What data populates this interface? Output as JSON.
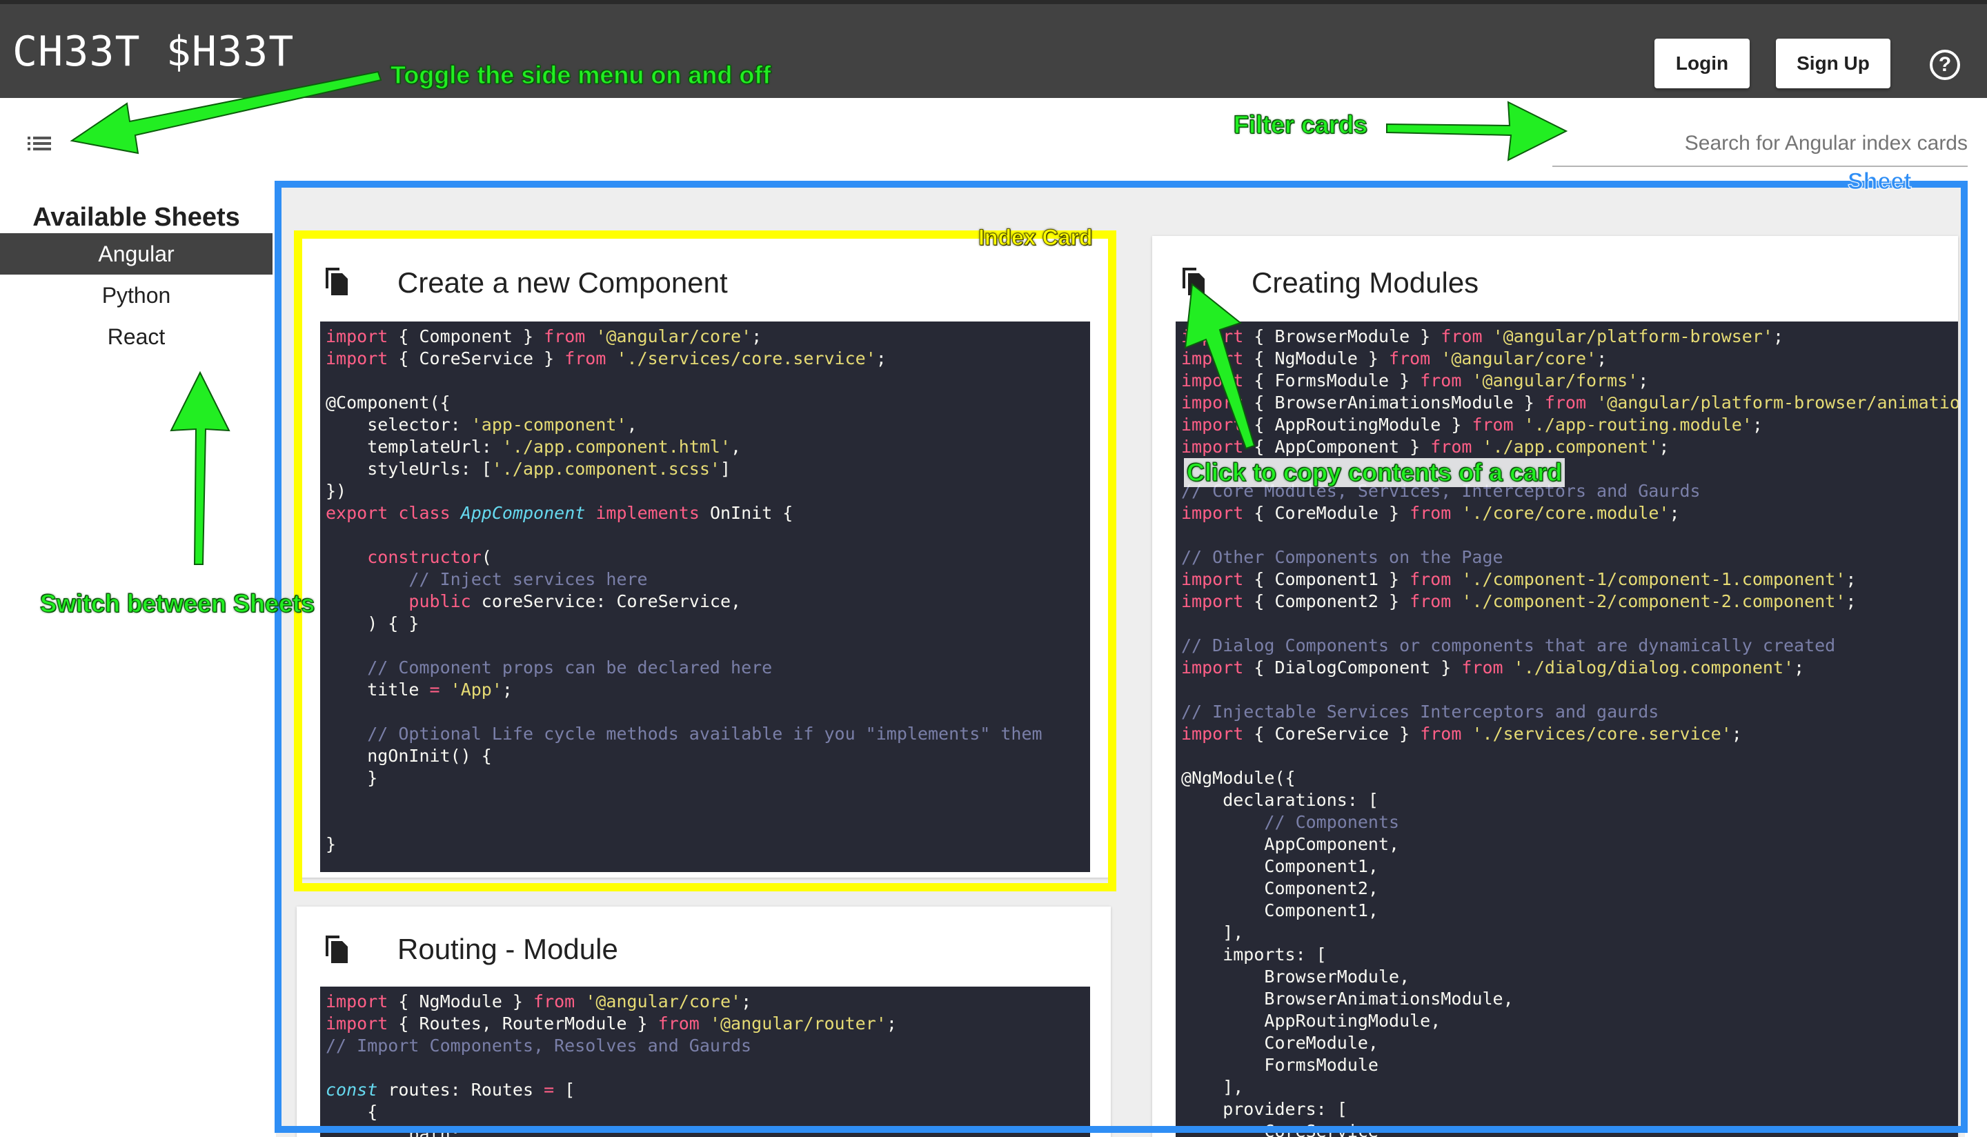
{
  "header": {
    "logo": "CH33T $H33T",
    "login_label": "Login",
    "signup_label": "Sign Up",
    "help_glyph": "?"
  },
  "toolbar": {
    "menu_icon": "list-icon",
    "search_placeholder": "Search for Angular index cards"
  },
  "sidebar": {
    "title": "Available Sheets",
    "items": [
      {
        "label": "Angular",
        "active": true
      },
      {
        "label": "Python",
        "active": false
      },
      {
        "label": "React",
        "active": false
      }
    ]
  },
  "cards": [
    {
      "title": "Create a new Component",
      "code_lines": [
        "import { Component } from '@angular/core';",
        "import { CoreService } from './services/core.service';",
        "",
        "@Component({",
        "    selector: 'app-component',",
        "    templateUrl: './app.component.html',",
        "    styleUrls: ['./app.component.scss']",
        "})",
        "export class AppComponent implements OnInit {",
        "",
        "    constructor(",
        "        // Inject services here",
        "        public coreService: CoreService,",
        "    ) { }",
        "",
        "    // Component props can be declared here",
        "    title = 'App';",
        "",
        "    // Optional Life cycle methods available if you \"implements\" them",
        "    ngOnInit() {",
        "    }",
        "",
        "",
        "}"
      ]
    },
    {
      "title": "Routing - Module",
      "code_lines": [
        "import { NgModule } from '@angular/core';",
        "import { Routes, RouterModule } from '@angular/router';",
        "// Import Components, Resolves and Gaurds",
        "",
        "const routes: Routes = [",
        "    {",
        "        path: ''"
      ]
    },
    {
      "title": "Creating Modules",
      "code_lines": [
        "import { BrowserModule } from '@angular/platform-browser';",
        "import { NgModule } from '@angular/core';",
        "import { FormsModule } from '@angular/forms';",
        "import { BrowserAnimationsModule } from '@angular/platform-browser/animations';",
        "import { AppRoutingModule } from './app-routing.module';",
        "import { AppComponent } from './app.component';",
        "",
        "// Core Modules, Services, Interceptors and Gaurds",
        "import { CoreModule } from './core/core.module';",
        "",
        "// Other Components on the Page",
        "import { Component1 } from './component-1/component-1.component';",
        "import { Component2 } from './component-2/component-2.component';",
        "",
        "// Dialog Components or components that are dynamically created",
        "import { DialogComponent } from './dialog/dialog.component';",
        "",
        "// Injectable Services Interceptors and gaurds",
        "import { CoreService } from './services/core.service';",
        "",
        "@NgModule({",
        "    declarations: [",
        "        // Components",
        "        AppComponent,",
        "        Component1,",
        "        Component2,",
        "        Component1,",
        "    ],",
        "    imports: [",
        "        BrowserModule,",
        "        BrowserAnimationsModule,",
        "        AppRoutingModule,",
        "        CoreModule,",
        "        FormsModule",
        "    ],",
        "    providers: [",
        "        CoreService"
      ]
    }
  ],
  "annotations": {
    "toggle_menu": "Toggle the side menu on and off",
    "filter_cards": "Filter cards",
    "sheet": "Sheet",
    "index_card": "Index Card",
    "copy_card": "Click to copy contents of a card",
    "switch_sheets": "Switch between Sheets"
  },
  "colors": {
    "header_bg": "#424242",
    "active_item_bg": "#424242",
    "code_bg": "#272935",
    "annotation_green": "#22ee22",
    "annotation_yellow": "#ffff00",
    "annotation_blue": "#2f8ef5"
  }
}
